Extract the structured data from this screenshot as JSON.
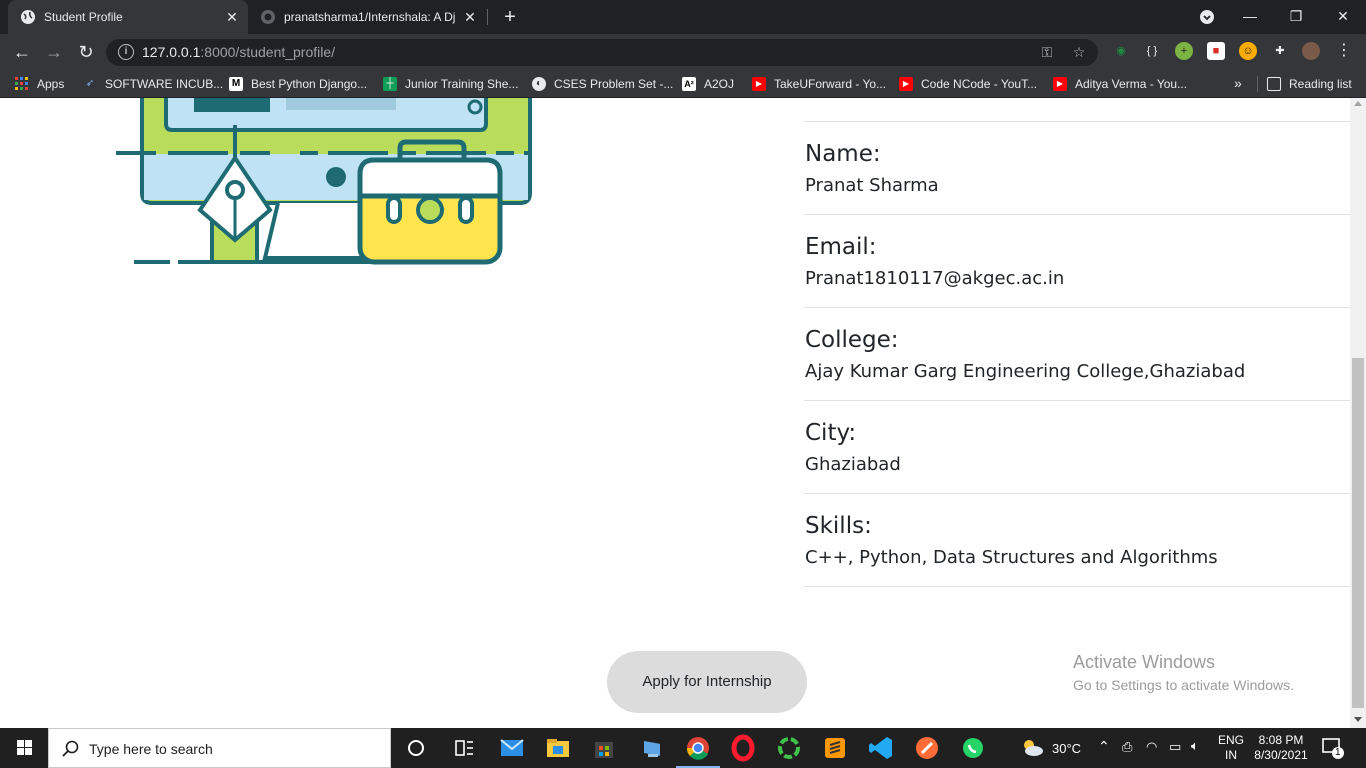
{
  "browser": {
    "tabs": [
      {
        "title": "Student Profile",
        "active": true
      },
      {
        "title": "pranatsharma1/Internshala: A Dj",
        "active": false
      }
    ],
    "new_tab": "+",
    "url_host": "127.0.0.1",
    "url_rest": ":8000/student_profile/",
    "bookmarks": [
      {
        "label": "Apps"
      },
      {
        "label": "SOFTWARE INCUB..."
      },
      {
        "label": "Best Python Django..."
      },
      {
        "label": "Junior Training She..."
      },
      {
        "label": "CSES Problem Set -..."
      },
      {
        "label": "A2OJ"
      },
      {
        "label": "TakeUForward - Yo..."
      },
      {
        "label": "Code NCode - YouT..."
      },
      {
        "label": "Aditya Verma - You..."
      }
    ],
    "more_bookmarks": "»",
    "reading_list": "Reading list"
  },
  "profile": {
    "fields": [
      {
        "label": "Name:",
        "value": "Pranat Sharma"
      },
      {
        "label": "Email:",
        "value": "Pranat1810117@akgec.ac.in"
      },
      {
        "label": "College:",
        "value": "Ajay Kumar Garg Engineering College,Ghaziabad"
      },
      {
        "label": "City:",
        "value": "Ghaziabad"
      },
      {
        "label": "Skills:",
        "value": "C++, Python, Data Structures and Algorithms"
      }
    ]
  },
  "apply_button": "Apply for Internship",
  "watermark": {
    "line1": "Activate Windows",
    "line2": "Go to Settings to activate Windows."
  },
  "taskbar": {
    "search_placeholder": "Type here to search",
    "weather": "30°C",
    "language": "ENG",
    "region": "IN",
    "time": "8:08 PM",
    "date": "8/30/2021",
    "notification_count": "1"
  }
}
